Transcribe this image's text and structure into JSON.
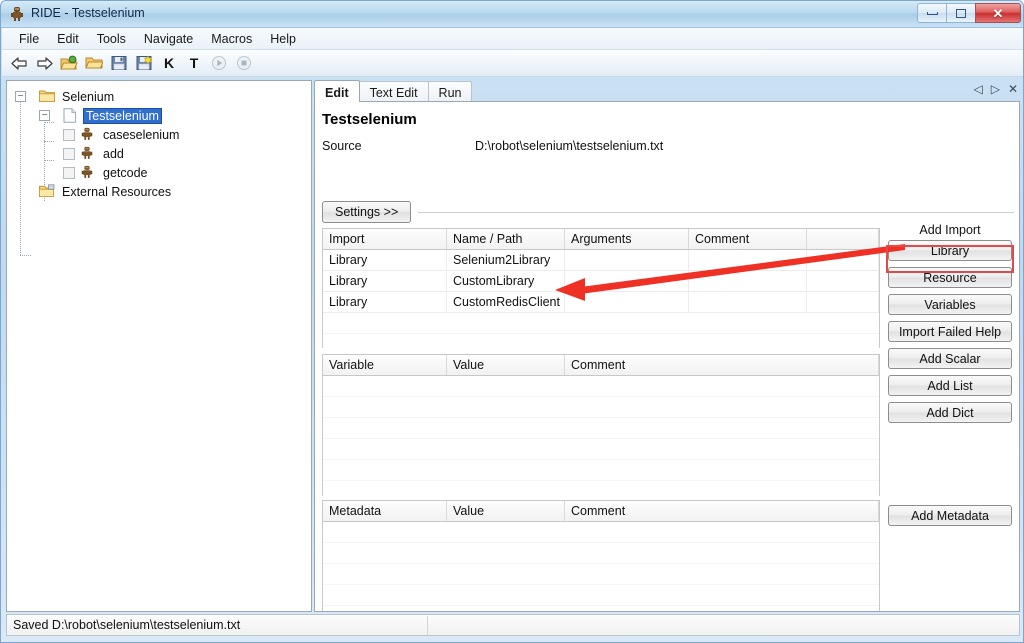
{
  "window": {
    "title": "RIDE - Testselenium",
    "icon": "robot-icon",
    "minimize_label": "Minimize",
    "maximize_label": "Maximize",
    "close_label": "Close",
    "close_glyph": "✕"
  },
  "menubar": {
    "items": [
      {
        "label": "File",
        "name": "menu-file"
      },
      {
        "label": "Edit",
        "name": "menu-edit"
      },
      {
        "label": "Tools",
        "name": "menu-tools"
      },
      {
        "label": "Navigate",
        "name": "menu-navigate"
      },
      {
        "label": "Macros",
        "name": "menu-macros"
      },
      {
        "label": "Help",
        "name": "menu-help"
      }
    ]
  },
  "toolbar": {
    "items": [
      {
        "name": "back-arrow-icon",
        "tooltip": "Back"
      },
      {
        "name": "forward-arrow-icon",
        "tooltip": "Forward"
      },
      {
        "name": "open-new-project-icon",
        "tooltip": "Open New Project"
      },
      {
        "name": "open-folder-icon",
        "tooltip": "Open Directory"
      },
      {
        "name": "save-icon",
        "tooltip": "Save"
      },
      {
        "name": "save-all-icon",
        "tooltip": "Save All"
      },
      {
        "name": "search-keyword-icon",
        "tooltip": "K",
        "label": "K"
      },
      {
        "name": "search-tests-icon",
        "tooltip": "T",
        "label": "T"
      },
      {
        "name": "run-icon",
        "tooltip": "Run"
      },
      {
        "name": "stop-icon",
        "tooltip": "Stop"
      }
    ]
  },
  "tree": {
    "nodes": [
      {
        "label": "Selenium",
        "indent": 0,
        "expander": "−",
        "icon": "folder-icon",
        "checkbox": false,
        "selected": false,
        "name": "tree-node-selenium"
      },
      {
        "label": "Testselenium",
        "indent": 1,
        "expander": "−",
        "icon": "file-icon",
        "checkbox": false,
        "selected": true,
        "name": "tree-node-testselenium"
      },
      {
        "label": "caseselenium",
        "indent": 2,
        "expander": "",
        "icon": "robot-icon",
        "checkbox": true,
        "selected": false,
        "name": "tree-node-caseselenium"
      },
      {
        "label": "add",
        "indent": 2,
        "expander": "",
        "icon": "robot-icon",
        "checkbox": true,
        "selected": false,
        "name": "tree-node-add"
      },
      {
        "label": "getcode",
        "indent": 2,
        "expander": "",
        "icon": "robot-icon",
        "checkbox": true,
        "selected": false,
        "name": "tree-node-getcode"
      },
      {
        "label": "External Resources",
        "indent": 1,
        "expander": "",
        "icon": "folder-link-icon",
        "checkbox": false,
        "selected": false,
        "name": "tree-node-external-resources"
      }
    ]
  },
  "editor": {
    "tabs": [
      {
        "label": "Edit",
        "active": true,
        "name": "tab-edit"
      },
      {
        "label": "Text Edit",
        "active": false,
        "name": "tab-text-edit"
      },
      {
        "label": "Run",
        "active": false,
        "name": "tab-run"
      }
    ],
    "tab_nav": {
      "prev": "◁",
      "next": "▷",
      "close": "✕"
    },
    "title": "Testselenium",
    "source_label": "Source",
    "source_value": "D:\\robot\\selenium\\testselenium.txt",
    "settings_button": "Settings >>"
  },
  "import_grid": {
    "headers": [
      "Import",
      "Name / Path",
      "Arguments",
      "Comment"
    ],
    "rows": [
      {
        "import": "Library",
        "name_path": "Selenium2Library",
        "arguments": "",
        "comment": ""
      },
      {
        "import": "Library",
        "name_path": "CustomLibrary",
        "arguments": "",
        "comment": ""
      },
      {
        "import": "Library",
        "name_path": "CustomRedisClient",
        "arguments": "",
        "comment": ""
      }
    ],
    "empty_rows": 3
  },
  "variable_grid": {
    "headers": [
      "Variable",
      "Value",
      "Comment"
    ],
    "rows": [],
    "empty_rows": 6
  },
  "metadata_grid": {
    "headers": [
      "Metadata",
      "Value",
      "Comment"
    ],
    "rows": [],
    "empty_rows": 6
  },
  "side_buttons": {
    "add_import_label": "Add Import",
    "import_buttons": [
      {
        "label": "Library",
        "name": "add-library-button",
        "highlighted": true
      },
      {
        "label": "Resource",
        "name": "add-resource-button",
        "highlighted": false
      },
      {
        "label": "Variables",
        "name": "add-variables-button",
        "highlighted": false
      },
      {
        "label": "Import Failed Help",
        "name": "import-failed-help-button",
        "highlighted": false
      }
    ],
    "variable_buttons": [
      {
        "label": "Add Scalar",
        "name": "add-scalar-button"
      },
      {
        "label": "Add List",
        "name": "add-list-button"
      },
      {
        "label": "Add Dict",
        "name": "add-dict-button"
      }
    ],
    "metadata_buttons": [
      {
        "label": "Add Metadata",
        "name": "add-metadata-button"
      }
    ]
  },
  "annotation": {
    "arrow_color": "#ee3124",
    "highlight_color": "#e04a4a",
    "points_from": "add-library-button",
    "points_to": "CustomRedisClient"
  },
  "statusbar": {
    "message": "Saved D:\\robot\\selenium\\testselenium.txt"
  }
}
